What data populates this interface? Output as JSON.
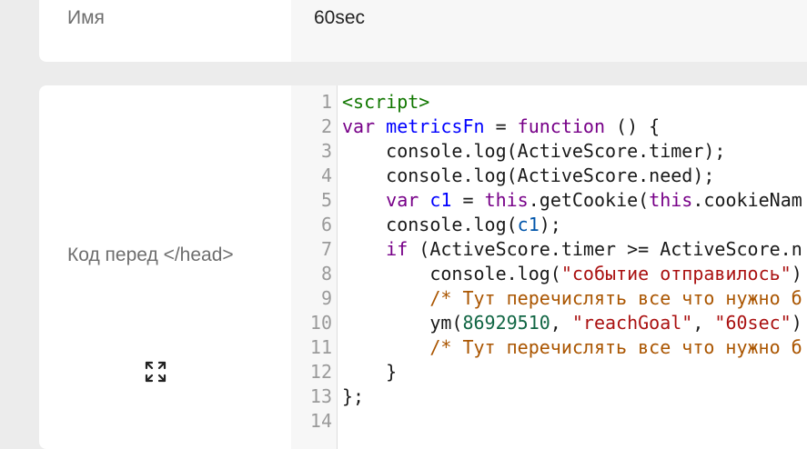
{
  "fields": {
    "name": {
      "label": "Имя",
      "value": "60sec"
    },
    "head_code": {
      "label": "Код перед </head>",
      "expand_icon": "expand-icon"
    }
  },
  "editor": {
    "line_numbers": [
      "1",
      "2",
      "3",
      "4",
      "5",
      "6",
      "7",
      "8",
      "9",
      "10",
      "11",
      "12",
      "13",
      "14"
    ],
    "lines": [
      [
        {
          "t": "tag",
          "v": "<script>"
        }
      ],
      [
        {
          "t": "kw",
          "v": "var"
        },
        {
          "t": "p",
          "v": " "
        },
        {
          "t": "def",
          "v": "metricsFn"
        },
        {
          "t": "p",
          "v": " = "
        },
        {
          "t": "kw",
          "v": "function"
        },
        {
          "t": "p",
          "v": " () {"
        }
      ],
      [
        {
          "t": "p",
          "v": "    console.log(ActiveScore.timer);"
        }
      ],
      [
        {
          "t": "p",
          "v": "    console.log(ActiveScore.need);"
        }
      ],
      [
        {
          "t": "p",
          "v": "    "
        },
        {
          "t": "kw",
          "v": "var"
        },
        {
          "t": "p",
          "v": " "
        },
        {
          "t": "def",
          "v": "c1"
        },
        {
          "t": "p",
          "v": " = "
        },
        {
          "t": "kw",
          "v": "this"
        },
        {
          "t": "p",
          "v": ".getCookie("
        },
        {
          "t": "kw",
          "v": "this"
        },
        {
          "t": "p",
          "v": ".cookieNam"
        }
      ],
      [
        {
          "t": "p",
          "v": "    console.log("
        },
        {
          "t": "var",
          "v": "c1"
        },
        {
          "t": "p",
          "v": ");"
        }
      ],
      [
        {
          "t": "p",
          "v": "    "
        },
        {
          "t": "kw",
          "v": "if"
        },
        {
          "t": "p",
          "v": " (ActiveScore.timer >= ActiveScore.n"
        }
      ],
      [
        {
          "t": "p",
          "v": "        console.log("
        },
        {
          "t": "str",
          "v": "\"событие отправилось\""
        },
        {
          "t": "p",
          "v": ")"
        }
      ],
      [
        {
          "t": "p",
          "v": "        "
        },
        {
          "t": "com",
          "v": "/* Тут перечислять все что нужно б"
        }
      ],
      [
        {
          "t": "p",
          "v": "        ym("
        },
        {
          "t": "num",
          "v": "86929510"
        },
        {
          "t": "p",
          "v": ", "
        },
        {
          "t": "str",
          "v": "\"reachGoal\""
        },
        {
          "t": "p",
          "v": ", "
        },
        {
          "t": "str",
          "v": "\"60sec\""
        },
        {
          "t": "p",
          "v": ")"
        }
      ],
      [
        {
          "t": "p",
          "v": "        "
        },
        {
          "t": "com",
          "v": "/* Тут перечислять все что нужно б"
        }
      ],
      [
        {
          "t": "p",
          "v": "    }"
        }
      ],
      [
        {
          "t": "p",
          "v": "};"
        }
      ],
      [
        {
          "t": "p",
          "v": ""
        }
      ]
    ]
  }
}
